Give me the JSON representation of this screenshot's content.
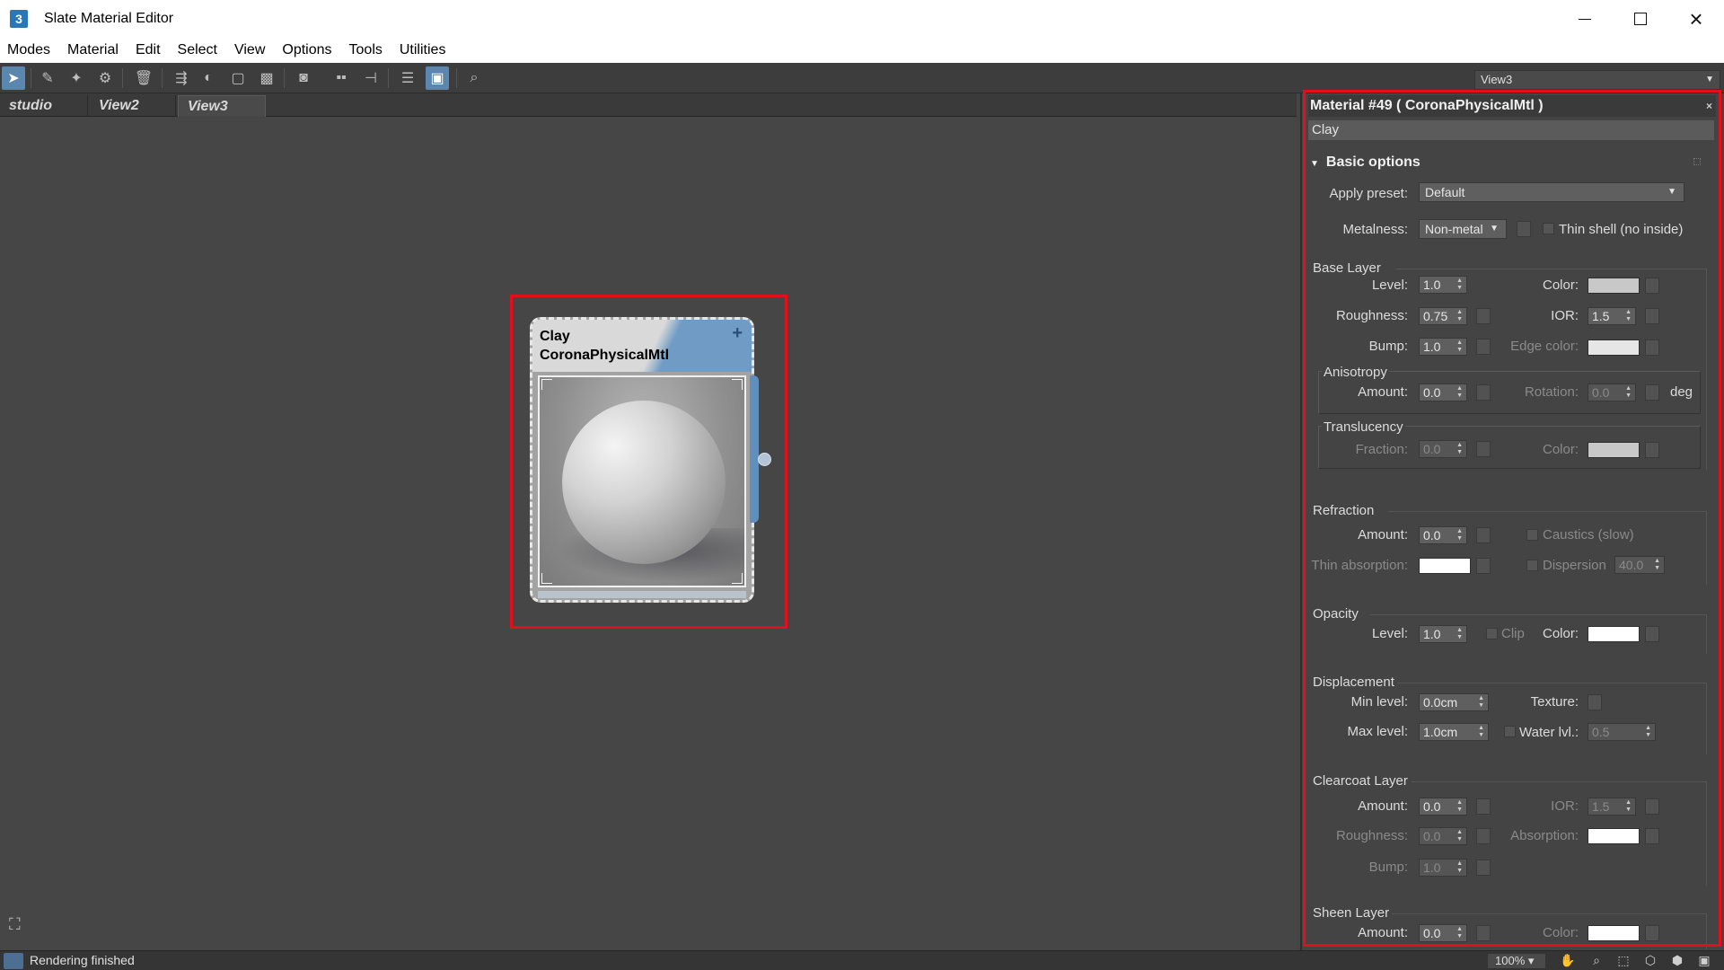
{
  "window": {
    "title": "Slate Material Editor",
    "app_icon": "3"
  },
  "menu": [
    "Modes",
    "Material",
    "Edit",
    "Select",
    "View",
    "Options",
    "Tools",
    "Utilities"
  ],
  "toolbar": {
    "icons": [
      "select-arrow-icon",
      "eyedropper-icon",
      "pick-material-icon",
      "put-to-scene-icon",
      "delete-icon",
      "move-children-icon",
      "hide-unused-icon",
      "layout-icon",
      "background-icon",
      "show-map-icon",
      "material-id-icon",
      "assign-icon",
      "layout-children-icon",
      "show-in-viewport-icon",
      "preview-icon",
      "navigator-icon"
    ],
    "view_select": "View3"
  },
  "tabs": [
    "studio",
    "View2",
    "View3"
  ],
  "active_tab": "View3",
  "node": {
    "name": "Clay",
    "type": "CoronaPhysicalMtl",
    "add_symbol": "+"
  },
  "panel": {
    "header": "Material #49  ( CoronaPhysicalMtl )",
    "name": "Clay",
    "rollout": "Basic options",
    "apply_preset": {
      "label": "Apply preset:",
      "value": "Default"
    },
    "metalness": {
      "label": "Metalness:",
      "value": "Non-metal"
    },
    "thin_shell": "Thin shell (no inside)",
    "base_layer": {
      "title": "Base Layer",
      "level": {
        "label": "Level:",
        "value": "1.0"
      },
      "color": {
        "label": "Color:",
        "swatch": "#c8c8c8"
      },
      "roughness": {
        "label": "Roughness:",
        "value": "0.75"
      },
      "ior": {
        "label": "IOR:",
        "value": "1.5"
      },
      "bump": {
        "label": "Bump:",
        "value": "1.0"
      },
      "edge_color": {
        "label": "Edge color:",
        "swatch": "#e6e6e6"
      }
    },
    "anisotropy": {
      "title": "Anisotropy",
      "amount": {
        "label": "Amount:",
        "value": "0.0"
      },
      "rotation": {
        "label": "Rotation:",
        "value": "0.0"
      },
      "unit": "deg"
    },
    "translucency": {
      "title": "Translucency",
      "fraction": {
        "label": "Fraction:",
        "value": "0.0"
      },
      "color": {
        "label": "Color:",
        "swatch": "#c8c8c8"
      }
    },
    "refraction": {
      "title": "Refraction",
      "amount": {
        "label": "Amount:",
        "value": "0.0"
      },
      "caustics": "Caustics (slow)",
      "thin_absorption": {
        "label": "Thin absorption:",
        "swatch": "#ffffff"
      },
      "dispersion": {
        "label": "Dispersion",
        "value": "40.0"
      }
    },
    "opacity": {
      "title": "Opacity",
      "level": {
        "label": "Level:",
        "value": "1.0"
      },
      "clip": "Clip",
      "color": {
        "label": "Color:",
        "swatch": "#ffffff"
      }
    },
    "displacement": {
      "title": "Displacement",
      "min_level": {
        "label": "Min level:",
        "value": "0.0cm"
      },
      "texture": {
        "label": "Texture:"
      },
      "max_level": {
        "label": "Max level:",
        "value": "1.0cm"
      },
      "water_lvl": {
        "label": "Water lvl.:",
        "value": "0.5"
      }
    },
    "clearcoat": {
      "title": "Clearcoat Layer",
      "amount": {
        "label": "Amount:",
        "value": "0.0"
      },
      "ior": {
        "label": "IOR:",
        "value": "1.5"
      },
      "roughness": {
        "label": "Roughness:",
        "value": "0.0"
      },
      "absorption": {
        "label": "Absorption:",
        "swatch": "#ffffff"
      },
      "bump": {
        "label": "Bump:",
        "value": "1.0"
      }
    },
    "sheen": {
      "title": "Sheen Layer",
      "amount": {
        "label": "Amount:",
        "value": "0.0"
      },
      "color": {
        "label": "Color:",
        "swatch": "#ffffff"
      }
    }
  },
  "status": {
    "text": "Rendering finished",
    "zoom": "100%"
  },
  "colors": {
    "highlight": "#e3101c",
    "node_header": "#6f9bc4",
    "canvas": "#464646"
  }
}
